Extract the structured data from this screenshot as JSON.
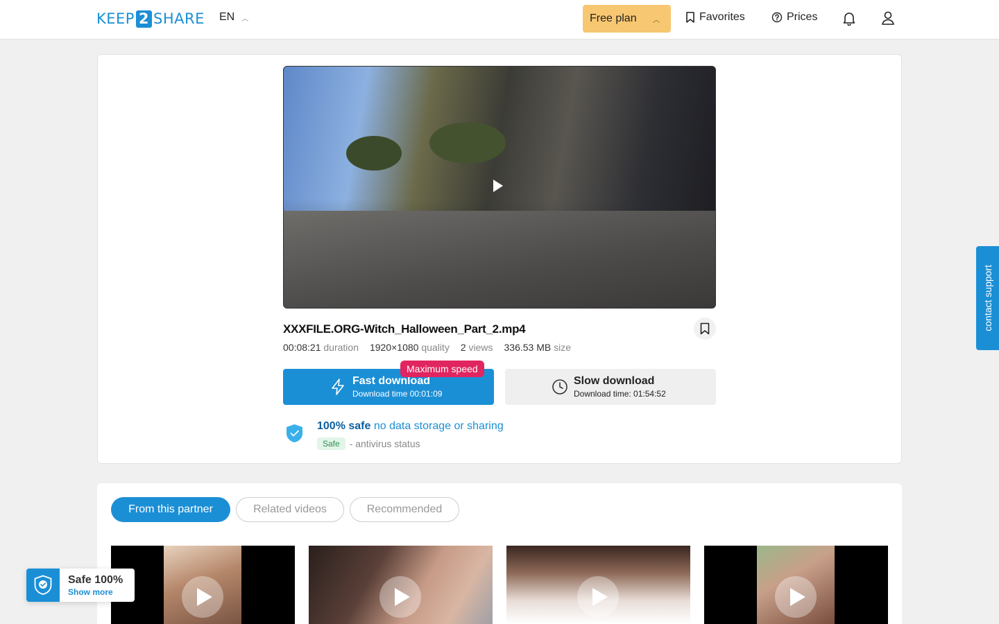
{
  "header": {
    "logo_left": "KEEP",
    "logo_mid": "2",
    "logo_right": "SHARE",
    "language": "EN",
    "free_plan_label": "Free plan",
    "favorites_label": "Favorites",
    "prices_label": "Prices"
  },
  "file": {
    "title": "XXXFILE.ORG-Witch_Halloween_Part_2.mp4",
    "duration": "00:08:21",
    "duration_label": "duration",
    "quality": "1920×1080",
    "quality_label": "quality",
    "views": "2",
    "views_label": "views",
    "size": "336.53 MB",
    "size_label": "size"
  },
  "downloads": {
    "fast_title": "Fast download",
    "fast_time": "Download time 00:01:09",
    "badge": "Maximum speed",
    "slow_title": "Slow download",
    "slow_time": "Download time: 01:54:52"
  },
  "safety": {
    "headline_bold": "100% safe",
    "headline_rest": "no data storage or sharing",
    "status_pill": "Safe",
    "status_text": "- antivirus status"
  },
  "contact_support": "contact support",
  "tabs": [
    {
      "label": "From this partner",
      "active": true
    },
    {
      "label": "Related videos",
      "active": false
    },
    {
      "label": "Recommended",
      "active": false
    }
  ],
  "safe_widget": {
    "title": "Safe 100%",
    "link": "Show more"
  },
  "colors": {
    "brand_blue": "#1b8fd6",
    "free_plan_bg": "#f8c772",
    "badge_red": "#e02560",
    "safe_green": "#2f8e52"
  },
  "icons": [
    "bookmark-icon",
    "help-circle-icon",
    "bell-icon",
    "user-icon",
    "lightning-icon",
    "clock-icon",
    "shield-check-icon",
    "play-icon",
    "chevron-up-icon"
  ]
}
